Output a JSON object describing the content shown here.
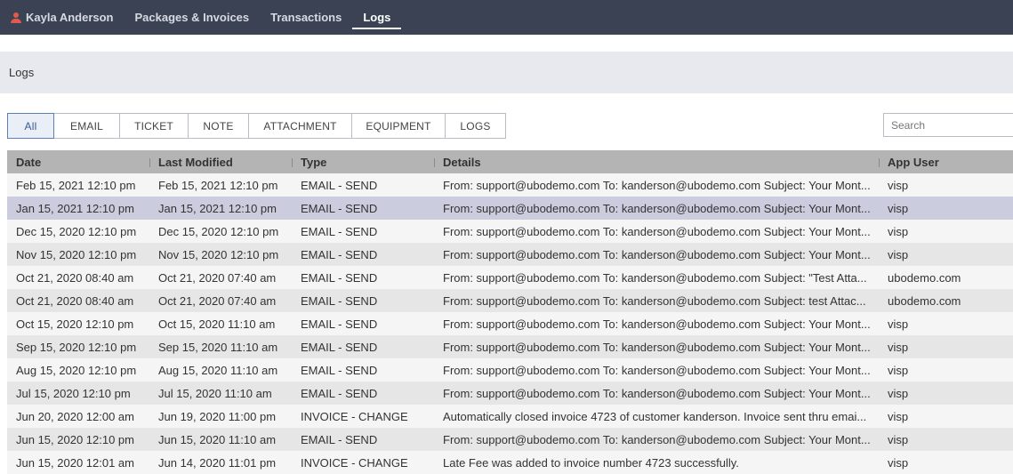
{
  "nav": {
    "user_name": "Kayla Anderson",
    "items": [
      "Packages & Invoices",
      "Transactions",
      "Logs"
    ],
    "active": "Logs",
    "user_icon_color": "#e05a4e",
    "bar_color": "#3a4253"
  },
  "section": {
    "title": "Logs"
  },
  "filters": {
    "items": [
      "All",
      "EMAIL",
      "TICKET",
      "NOTE",
      "ATTACHMENT",
      "EQUIPMENT",
      "LOGS"
    ],
    "active": "All"
  },
  "search": {
    "placeholder": "Search",
    "value": ""
  },
  "table": {
    "columns": [
      "Date",
      "Last Modified",
      "Type",
      "Details",
      "App User"
    ],
    "selected_row": 1,
    "rows": [
      [
        "Feb 15, 2021 12:10 pm",
        "Feb 15, 2021 12:10 pm",
        "EMAIL - SEND",
        "From: support@ubodemo.com To: kanderson@ubodemo.com Subject: Your Mont...",
        "visp"
      ],
      [
        "Jan 15, 2021 12:10 pm",
        "Jan 15, 2021 12:10 pm",
        "EMAIL - SEND",
        "From: support@ubodemo.com To: kanderson@ubodemo.com Subject: Your Mont...",
        "visp"
      ],
      [
        "Dec 15, 2020 12:10 pm",
        "Dec 15, 2020 12:10 pm",
        "EMAIL - SEND",
        "From: support@ubodemo.com To: kanderson@ubodemo.com Subject: Your Mont...",
        "visp"
      ],
      [
        "Nov 15, 2020 12:10 pm",
        "Nov 15, 2020 12:10 pm",
        "EMAIL - SEND",
        "From: support@ubodemo.com To: kanderson@ubodemo.com Subject: Your Mont...",
        "visp"
      ],
      [
        "Oct 21, 2020 08:40 am",
        "Oct 21, 2020 07:40 am",
        "EMAIL - SEND",
        "From: support@ubodemo.com To: kanderson@ubodemo.com Subject: \"Test Atta...",
        "ubodemo.com"
      ],
      [
        "Oct 21, 2020 08:40 am",
        "Oct 21, 2020 07:40 am",
        "EMAIL - SEND",
        "From: support@ubodemo.com To: kanderson@ubodemo.com Subject: test Attac...",
        "ubodemo.com"
      ],
      [
        "Oct 15, 2020 12:10 pm",
        "Oct 15, 2020 11:10 am",
        "EMAIL - SEND",
        "From: support@ubodemo.com To: kanderson@ubodemo.com Subject: Your Mont...",
        "visp"
      ],
      [
        "Sep 15, 2020 12:10 pm",
        "Sep 15, 2020 11:10 am",
        "EMAIL - SEND",
        "From: support@ubodemo.com To: kanderson@ubodemo.com Subject: Your Mont...",
        "visp"
      ],
      [
        "Aug 15, 2020 12:10 pm",
        "Aug 15, 2020 11:10 am",
        "EMAIL - SEND",
        "From: support@ubodemo.com To: kanderson@ubodemo.com Subject: Your Mont...",
        "visp"
      ],
      [
        "Jul 15, 2020 12:10 pm",
        "Jul 15, 2020 11:10 am",
        "EMAIL - SEND",
        "From: support@ubodemo.com To: kanderson@ubodemo.com Subject: Your Mont...",
        "visp"
      ],
      [
        "Jun 20, 2020 12:00 am",
        "Jun 19, 2020 11:00 pm",
        "INVOICE - CHANGE",
        "Automatically closed invoice 4723 of customer kanderson. Invoice sent thru emai...",
        "visp"
      ],
      [
        "Jun 15, 2020 12:10 pm",
        "Jun 15, 2020 11:10 am",
        "EMAIL - SEND",
        "From: support@ubodemo.com To: kanderson@ubodemo.com Subject: Your Mont...",
        "visp"
      ],
      [
        "Jun 15, 2020 12:01 am",
        "Jun 14, 2020 11:01 pm",
        "INVOICE - CHANGE",
        "Late Fee was added to invoice number 4723 successfully.",
        "visp"
      ]
    ]
  }
}
